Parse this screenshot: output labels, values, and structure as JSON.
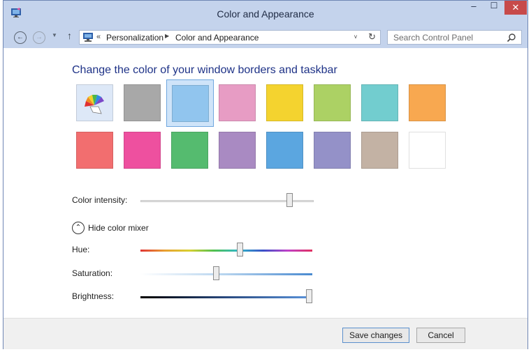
{
  "window": {
    "title": "Color and Appearance",
    "minimize_glyph": "‒",
    "maximize_glyph": "☐",
    "close_glyph": "✕"
  },
  "nav": {
    "back_glyph": "←",
    "forward_glyph": "→",
    "recent_glyph": "▼",
    "up_glyph": "↑",
    "breadcrumb_overflow": "«",
    "breadcrumb": [
      "Personalization",
      "Color and Appearance"
    ],
    "breadcrumb_separator": "▶",
    "dropdown_glyph": "v",
    "refresh_glyph": "↻"
  },
  "search": {
    "placeholder": "Search Control Panel"
  },
  "main": {
    "heading": "Change the color of your window borders and taskbar",
    "swatches_row1": [
      {
        "name": "automatic",
        "color": "#dde8f7",
        "selected": false
      },
      {
        "name": "gray",
        "color": "#a8a8a8",
        "selected": false
      },
      {
        "name": "sky",
        "color": "#91c5ee",
        "selected": true
      },
      {
        "name": "pink",
        "color": "#e79cc4",
        "selected": false
      },
      {
        "name": "yellow",
        "color": "#f4d32f",
        "selected": false
      },
      {
        "name": "green",
        "color": "#acd164",
        "selected": false
      },
      {
        "name": "teal",
        "color": "#72cdcf",
        "selected": false
      },
      {
        "name": "orange",
        "color": "#f8a850",
        "selected": false
      }
    ],
    "swatches_row2": [
      {
        "name": "red",
        "color": "#f26e6f",
        "selected": false
      },
      {
        "name": "magenta",
        "color": "#ee509f",
        "selected": false
      },
      {
        "name": "emerald",
        "color": "#55bb6f",
        "selected": false
      },
      {
        "name": "lavender",
        "color": "#a98ac2",
        "selected": false
      },
      {
        "name": "blue",
        "color": "#5ba6e0",
        "selected": false
      },
      {
        "name": "periwinkle",
        "color": "#9491c8",
        "selected": false
      },
      {
        "name": "taupe",
        "color": "#c3b2a4",
        "selected": false
      },
      {
        "name": "white",
        "color": "#ffffff",
        "selected": false
      }
    ],
    "color_intensity_label": "Color intensity:",
    "color_intensity_value": 0.86,
    "mixer_toggle_label": "Hide color mixer",
    "mixer_toggle_glyph": "⌃",
    "hue_label": "Hue:",
    "hue_value": 0.58,
    "saturation_label": "Saturation:",
    "saturation_value": 0.44,
    "brightness_label": "Brightness:",
    "brightness_value": 0.98
  },
  "footer": {
    "save_label": "Save changes",
    "cancel_label": "Cancel"
  }
}
